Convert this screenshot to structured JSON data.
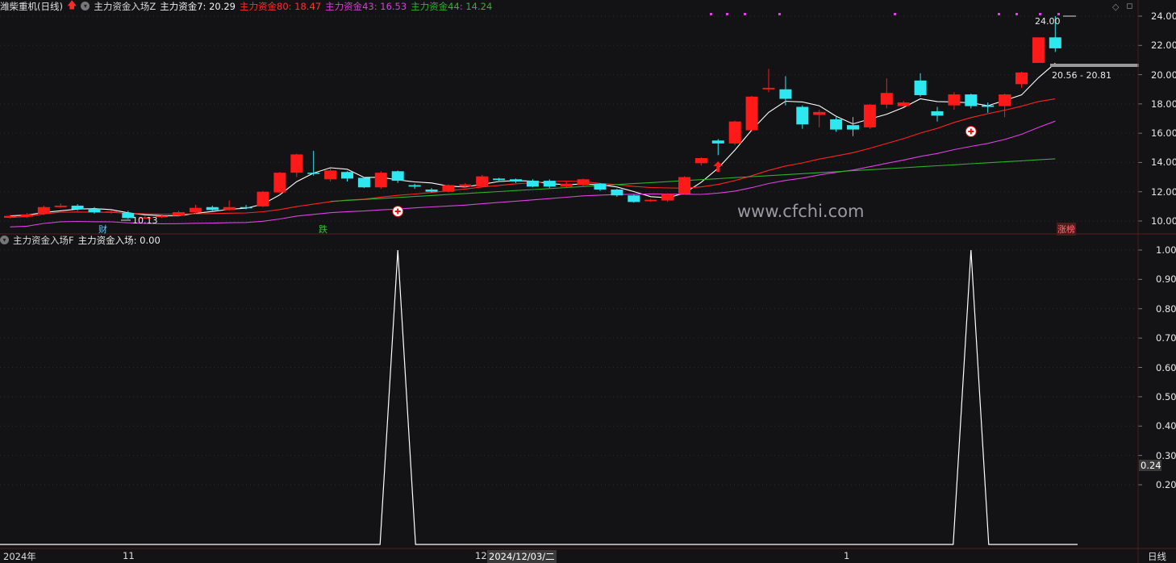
{
  "header": {
    "stock": "潍柴重机(日线)",
    "indicator": "主力资金入场Z",
    "ma7_label": "主力资金7: 20.29",
    "ma80_label": "主力资金80: 18.47",
    "ma43_label": "主力资金43: 16.53",
    "ma44_label": "主力资金44: 14.24"
  },
  "sub_header": {
    "indicator": "主力资金入场F",
    "value_label": "主力资金入场: 0.00"
  },
  "watermark": "www.cfchi.com",
  "price_axis": [
    "24.00",
    "22.00",
    "20.00",
    "18.00",
    "16.00",
    "14.00",
    "12.00",
    "10.00"
  ],
  "sub_axis": [
    "1.00",
    "0.90",
    "0.80",
    "0.70",
    "0.60",
    "0.50",
    "0.40",
    "0.30",
    "0.20"
  ],
  "sub_current": "0.24",
  "annotations": {
    "high": "24.00",
    "low": "10.13",
    "range": "20.56 - 20.81",
    "cai": "财",
    "die": "跌",
    "zhangbang": "涨榜"
  },
  "time_axis": {
    "year": "2024年",
    "m11": "11",
    "m12": "12",
    "cursor_date": "2024/12/03/二",
    "m1": "1",
    "period": "日线"
  },
  "colors": {
    "up": "#ff1a1a",
    "down": "#2ee8f0",
    "ma7": "#ffffff",
    "ma80": "#ff2424",
    "ma43": "#e040e6",
    "ma44": "#2fb02f"
  },
  "chart_data": {
    "type": "candlestick",
    "ylim": [
      9.6,
      24.6
    ],
    "candles": [
      [
        10.22,
        10.35,
        10.42,
        10.18
      ],
      [
        10.3,
        10.45,
        10.55,
        10.2
      ],
      [
        10.5,
        10.95,
        11.05,
        10.4
      ],
      [
        10.95,
        11.05,
        11.2,
        10.9
      ],
      [
        11.05,
        10.8,
        11.15,
        10.7
      ],
      [
        10.85,
        10.6,
        10.95,
        10.5
      ],
      [
        10.6,
        10.65,
        10.75,
        10.5
      ],
      [
        10.55,
        10.2,
        10.7,
        10.13
      ],
      [
        10.25,
        10.25,
        10.35,
        10.15
      ],
      [
        10.3,
        10.35,
        10.5,
        10.2
      ],
      [
        10.35,
        10.6,
        10.7,
        10.3
      ],
      [
        10.6,
        10.9,
        11.1,
        10.5
      ],
      [
        10.95,
        10.75,
        11.05,
        10.7
      ],
      [
        10.75,
        10.95,
        11.4,
        10.7
      ],
      [
        10.95,
        10.9,
        11.1,
        10.8
      ],
      [
        11.0,
        12.0,
        12.05,
        10.95
      ],
      [
        11.95,
        13.3,
        13.35,
        11.9
      ],
      [
        13.3,
        14.55,
        14.6,
        13.0
      ],
      [
        13.3,
        13.25,
        14.8,
        13.1
      ],
      [
        12.85,
        13.45,
        13.6,
        12.7
      ],
      [
        13.35,
        12.9,
        13.4,
        12.7
      ],
      [
        12.95,
        12.3,
        13.0,
        12.25
      ],
      [
        12.3,
        13.3,
        13.4,
        12.2
      ],
      [
        13.4,
        12.75,
        13.45,
        12.6
      ],
      [
        12.45,
        12.35,
        12.55,
        12.2
      ],
      [
        12.15,
        12.0,
        12.25,
        11.95
      ],
      [
        12.0,
        12.45,
        12.5,
        11.95
      ],
      [
        12.35,
        12.5,
        12.6,
        12.3
      ],
      [
        12.35,
        13.05,
        13.15,
        12.3
      ],
      [
        12.9,
        12.8,
        12.95,
        12.75
      ],
      [
        12.85,
        12.7,
        12.9,
        12.6
      ],
      [
        12.75,
        12.35,
        12.85,
        12.3
      ],
      [
        12.75,
        12.35,
        12.85,
        12.25
      ],
      [
        12.35,
        12.55,
        12.75,
        12.25
      ],
      [
        12.45,
        12.85,
        12.9,
        12.35
      ],
      [
        12.55,
        12.15,
        12.6,
        12.05
      ],
      [
        12.15,
        11.75,
        12.2,
        11.65
      ],
      [
        11.75,
        11.3,
        11.8,
        11.25
      ],
      [
        11.35,
        11.45,
        11.5,
        11.3
      ],
      [
        11.4,
        11.85,
        11.9,
        11.3
      ],
      [
        11.85,
        13.0,
        13.05,
        11.8
      ],
      [
        13.95,
        14.3,
        14.35,
        13.8
      ],
      [
        15.5,
        15.3,
        15.6,
        14.5
      ],
      [
        15.3,
        16.8,
        16.85,
        15.2
      ],
      [
        16.2,
        18.5,
        18.55,
        16.1
      ],
      [
        19.0,
        19.1,
        20.4,
        18.8
      ],
      [
        19.0,
        18.35,
        19.9,
        17.9
      ],
      [
        17.8,
        16.6,
        17.9,
        16.3
      ],
      [
        17.25,
        17.45,
        17.6,
        16.4
      ],
      [
        16.95,
        16.25,
        17.1,
        16.1
      ],
      [
        16.55,
        16.25,
        17.1,
        15.8
      ],
      [
        16.4,
        17.95,
        18.0,
        16.3
      ],
      [
        17.95,
        18.75,
        19.75,
        17.7
      ],
      [
        17.85,
        18.1,
        18.2,
        17.8
      ],
      [
        19.6,
        18.6,
        20.1,
        18.5
      ],
      [
        17.5,
        17.2,
        17.8,
        16.8
      ],
      [
        17.9,
        18.65,
        18.8,
        17.6
      ],
      [
        18.65,
        17.85,
        18.7,
        17.7
      ],
      [
        17.9,
        17.8,
        18.1,
        17.4
      ],
      [
        17.85,
        18.65,
        18.7,
        17.1
      ],
      [
        19.35,
        20.15,
        20.2,
        19.1
      ],
      [
        20.8,
        22.55,
        22.55,
        20.8
      ],
      [
        22.55,
        21.8,
        24.0,
        21.55
      ]
    ],
    "markers": {
      "zhuli_entry_indices": [
        23,
        57
      ],
      "arrow_index": 42
    },
    "sub_chart": {
      "type": "line",
      "ylim": [
        0.0,
        1.0
      ],
      "spikes": [
        23,
        57
      ]
    }
  }
}
